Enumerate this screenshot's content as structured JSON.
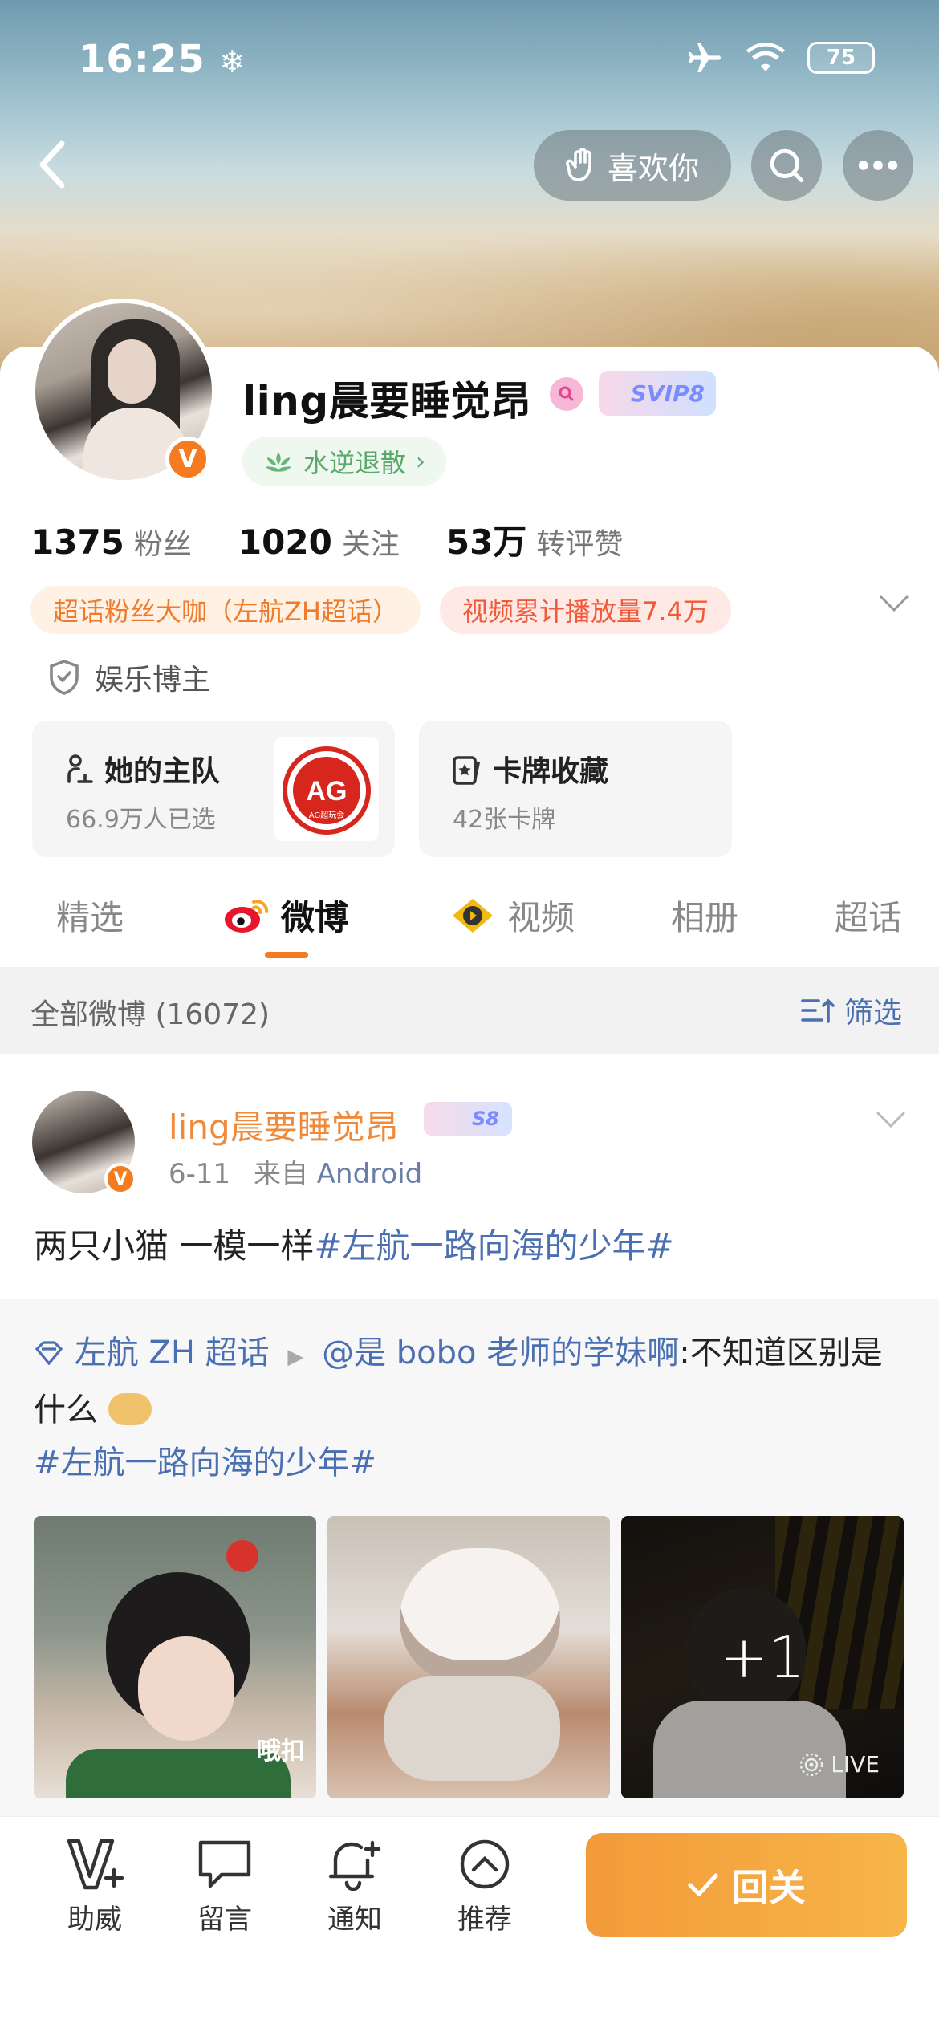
{
  "status_bar": {
    "time": "16:25",
    "battery": "75"
  },
  "header": {
    "like_label": "喜欢你"
  },
  "profile": {
    "username": "ling晨要睡觉昂",
    "svip_label": "SVIP8",
    "group_label": "水逆退散",
    "stats": [
      {
        "num": "1375",
        "label": "粉丝"
      },
      {
        "num": "1020",
        "label": "关注"
      },
      {
        "num": "53万",
        "label": "转评赞"
      }
    ],
    "tags": [
      "超话粉丝大咖（左航ZH超话）",
      "视频累计播放量7.4万"
    ],
    "role": "娱乐博主",
    "cards": [
      {
        "title": "她的主队",
        "sub": "66.9万人已选",
        "logo_text": "AG",
        "logo_sub": "AG超玩会"
      },
      {
        "title": "卡牌收藏",
        "sub": "42张卡牌"
      }
    ]
  },
  "tabs": [
    "精选",
    "微博",
    "视频",
    "相册",
    "超话"
  ],
  "active_tab": "微博",
  "filter_bar": {
    "count": "全部微博 (16072)",
    "filter_label": "筛选"
  },
  "post": {
    "author": "ling晨要睡觉昂",
    "level_badge": "S8",
    "date": "6-11",
    "source_prefix": "来自",
    "source": "Android",
    "text": "两只小猫 一模一样",
    "topic": "#左航一路向海的少年#",
    "repost": {
      "supertopic": "左航 ZH 超话",
      "mention": "@是 bobo 老师的学妹啊",
      "text": ":不知道区别是什么",
      "topic": "#左航一路向海的少年#"
    },
    "images": [
      {
        "caption": "哦扣"
      },
      {
        "caption": ""
      },
      {
        "more": "+1",
        "badge": "LIVE"
      }
    ]
  },
  "bottom_bar": {
    "items": [
      "助威",
      "留言",
      "通知",
      "推荐"
    ],
    "follow_label": "回关"
  },
  "colors": {
    "accent": "#f47b20",
    "link": "#4a6fb2",
    "follow_start": "#f39a3a",
    "follow_end": "#f7b548"
  }
}
